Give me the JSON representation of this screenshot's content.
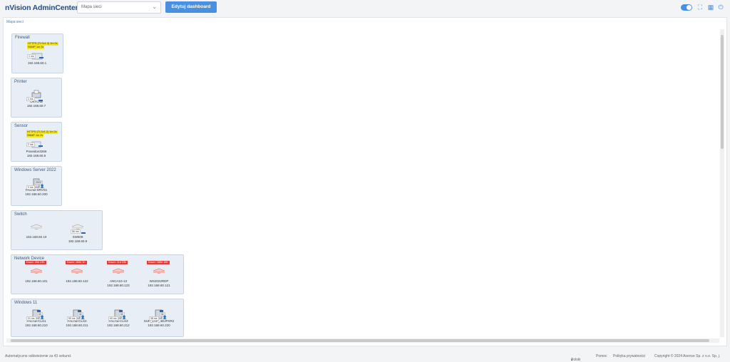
{
  "app": {
    "title": "nVision AdminCenter"
  },
  "toolbar": {
    "map_select_value": "Mapa sieci",
    "edit_label": "Edytuj dashboard"
  },
  "breadcrumb": "Mapa sieci",
  "groups": [
    {
      "title": "Firewall",
      "devices": [
        {
          "lines": [
            "192.168.60.1"
          ],
          "badges": [
            "HTTPS (TLSv1.3) 1m 2s",
            "SNMP 1m 2s"
          ],
          "ms": "1 ms"
        }
      ]
    },
    {
      "title": "Printer",
      "devices": [
        {
          "lines": [
            "OKI-LAB",
            "192.168.60.7"
          ],
          "ms": "1 ms"
        }
      ]
    },
    {
      "title": "Sensor",
      "devices": [
        {
          "lines": [
            "Poseidon3266",
            "192.168.60.5"
          ],
          "badges": [
            "HTTPS (TLSv1.2) 1m 2s",
            "SNMP 1m 2s"
          ],
          "ms": "2 ms"
        }
      ]
    },
    {
      "title": "Windows Server 2022",
      "devices": [
        {
          "lines": [
            "PALAB-SRVS1",
            "192.168.60.200"
          ],
          "ms": "0 ms",
          "tag": "2022"
        }
      ]
    },
    {
      "title": "Switch",
      "devices": [
        {
          "lines": [
            "192.168.60.10"
          ]
        },
        {
          "lines": [
            "SW609",
            "192.168.60.9"
          ],
          "ms": "56 ms"
        }
      ]
    },
    {
      "title": "Network Device",
      "devices": [
        {
          "lines": [
            "192.168.60.101"
          ],
          "down": "Down: 26d 23h"
        },
        {
          "lines": [
            "192.168.60.122"
          ],
          "down": "Down: 163d 1h"
        },
        {
          "lines": [
            "ANCA10-13",
            "192.168.60.123"
          ],
          "down": "Down: 11d 23h"
        },
        {
          "lines": [
            "WS2022RDP",
            "192.168.60.121"
          ],
          "down": "Down: 166d 18h"
        }
      ]
    },
    {
      "title": "Windows 11",
      "devices": [
        {
          "lines": [
            "PALAB-CLS1",
            "192.168.60.210"
          ],
          "ms": "21 ms",
          "tag": "11"
        },
        {
          "lines": [
            "PALAB-CLS2",
            "192.168.60.211"
          ],
          "ms": "59 ms",
          "tag": "11"
        },
        {
          "lines": [
            "PALAB-CLS3",
            "192.168.60.212"
          ],
          "ms": "90 ms",
          "tag": "11"
        },
        {
          "lines": [
            "SUP_LAP_4DJPXR2",
            "192.168.60.220"
          ],
          "ms": "38 ms",
          "tag": "11"
        }
      ]
    }
  ],
  "footer": {
    "refresh": "Automatyczne odświeżenie za 43 sekund.",
    "language": "Polski",
    "help": "Pomoc",
    "privacy": "Polityka prywatności",
    "copyright": "Copyright © 2024  Axence Sp. z o.o. Sp. j."
  },
  "colors": {
    "accent": "#4a90e2",
    "brand": "#1f4d8f",
    "down": "#e53935",
    "badge": "#f5e71c"
  }
}
